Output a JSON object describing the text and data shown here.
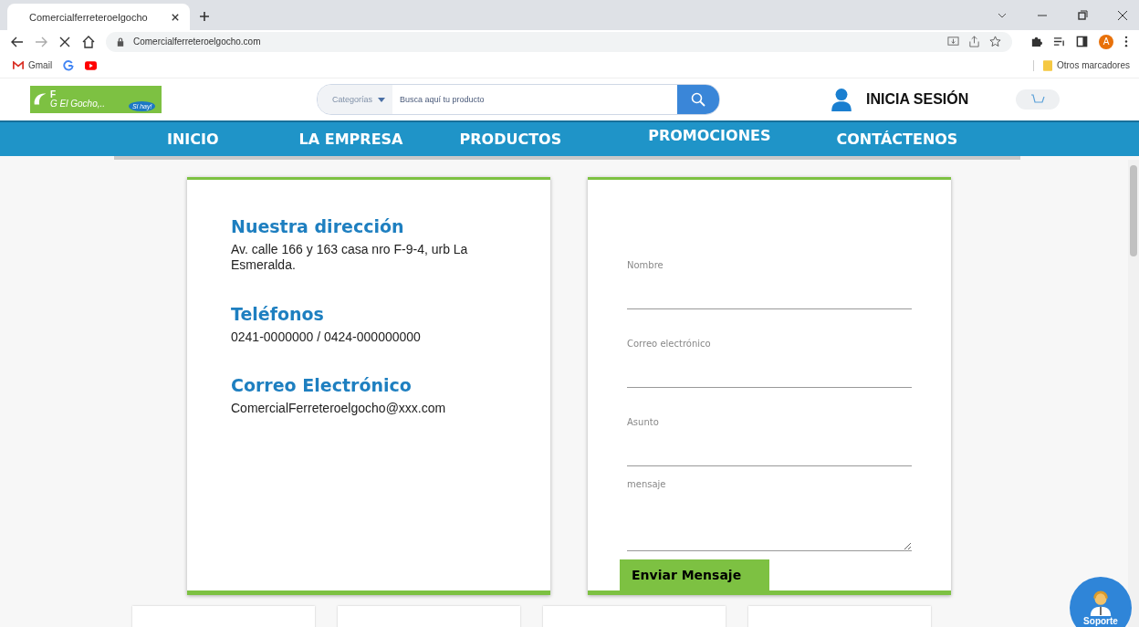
{
  "browser": {
    "tab_title": "Comercialferreteroelgocho",
    "url": "Comercialferreteroelgocho.com",
    "bookmarks": [
      {
        "kind": "gmail",
        "label": "Gmail"
      },
      {
        "kind": "google"
      },
      {
        "kind": "youtube"
      }
    ],
    "other_bookmarks": "Otros marcadores",
    "profile_initial": "A"
  },
  "header": {
    "logo": {
      "letter_top": "F",
      "letter_bottom": "G",
      "name": "El Gocho,..",
      "slogan": "Si hay!"
    },
    "search": {
      "category": "Categorías",
      "placeholder": "Busca aquí tu producto"
    },
    "login": "INICIA SESIÓN"
  },
  "nav": [
    "INICIO",
    "LA EMPRESA",
    "PRODUCTOS",
    "PROMOCIONES",
    "CONTÁCTENOS"
  ],
  "contact": {
    "sections": [
      {
        "title": "Nuestra dirección",
        "text": "Av. calle 166 y 163 casa nro F-9-4, urb La Esmeralda."
      },
      {
        "title": "Teléfonos",
        "text": "0241-0000000 / 0424-000000000"
      },
      {
        "title": "Correo Electrónico",
        "text": "ComercialFerreteroelgocho@xxx.com"
      }
    ]
  },
  "form": {
    "fields": [
      {
        "kind": "input",
        "placeholder": "Nombre"
      },
      {
        "kind": "input",
        "placeholder": "Correo electrónico"
      },
      {
        "kind": "input",
        "placeholder": "Asunto"
      },
      {
        "kind": "textarea",
        "placeholder": "mensaje"
      }
    ],
    "submit": "Enviar Mensaje"
  },
  "support": {
    "label": "Soporte"
  }
}
